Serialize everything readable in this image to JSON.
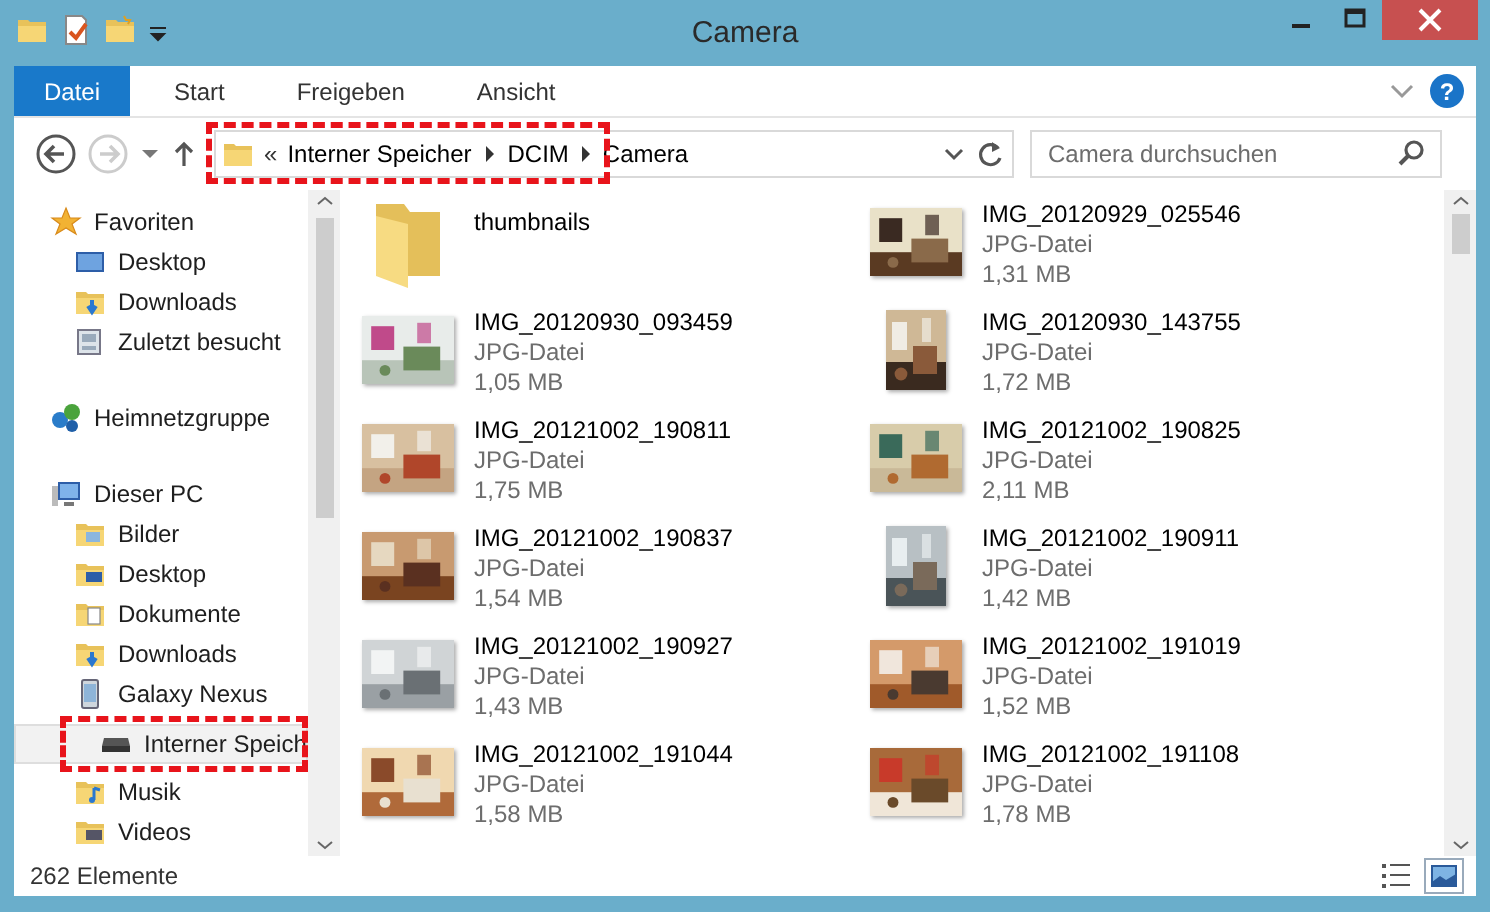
{
  "window": {
    "title": "Camera"
  },
  "ribbon": {
    "tabs": [
      {
        "label": "Datei",
        "selected": true
      },
      {
        "label": "Start",
        "selected": false
      },
      {
        "label": "Freigeben",
        "selected": false
      },
      {
        "label": "Ansicht",
        "selected": false
      }
    ],
    "help": "?"
  },
  "address_bar": {
    "overflow": "«",
    "segments": [
      "Interner Speicher",
      "DCIM",
      "Camera"
    ],
    "highlighted": true
  },
  "search": {
    "placeholder": "Camera durchsuchen"
  },
  "navigation": [
    {
      "label": "Favoriten",
      "kind": "star",
      "selected": false,
      "highlighted": false,
      "children": [
        {
          "label": "Desktop",
          "kind": "desktop",
          "selected": false,
          "highlighted": false
        },
        {
          "label": "Downloads",
          "kind": "downloads",
          "selected": false,
          "highlighted": false
        },
        {
          "label": "Zuletzt besucht",
          "kind": "recent",
          "selected": false,
          "highlighted": false
        }
      ]
    },
    {
      "label": "Heimnetzgruppe",
      "kind": "network",
      "selected": false,
      "highlighted": false
    },
    {
      "label": "Dieser PC",
      "kind": "pc",
      "selected": false,
      "highlighted": false,
      "children": [
        {
          "label": "Bilder",
          "kind": "pictures",
          "selected": false,
          "highlighted": false
        },
        {
          "label": "Desktop",
          "kind": "desktopfolder",
          "selected": false,
          "highlighted": false
        },
        {
          "label": "Dokumente",
          "kind": "documents",
          "selected": false,
          "highlighted": false
        },
        {
          "label": "Downloads",
          "kind": "downloads",
          "selected": false,
          "highlighted": false
        },
        {
          "label": "Galaxy Nexus",
          "kind": "phone",
          "selected": false,
          "highlighted": false,
          "children": [
            {
              "label": "Interner Speich",
              "kind": "drive",
              "selected": true,
              "highlighted": true
            }
          ]
        },
        {
          "label": "Musik",
          "kind": "music",
          "selected": false,
          "highlighted": false
        },
        {
          "label": "Videos",
          "kind": "videos",
          "selected": false,
          "highlighted": false
        }
      ]
    }
  ],
  "files": [
    {
      "kind": "folder",
      "name": "thumbnails"
    },
    {
      "name": "IMG_20120929_025546",
      "type": "JPG-Datei",
      "size": "1,31 MB"
    },
    {
      "name": "IMG_20120930_093459",
      "type": "JPG-Datei",
      "size": "1,05 MB"
    },
    {
      "name": "IMG_20120930_143755",
      "type": "JPG-Datei",
      "size": "1,72 MB"
    },
    {
      "name": "IMG_20121002_190811",
      "type": "JPG-Datei",
      "size": "1,75 MB"
    },
    {
      "name": "IMG_20121002_190825",
      "type": "JPG-Datei",
      "size": "2,11 MB"
    },
    {
      "name": "IMG_20121002_190837",
      "type": "JPG-Datei",
      "size": "1,54 MB"
    },
    {
      "name": "IMG_20121002_190911",
      "type": "JPG-Datei",
      "size": "1,42 MB"
    },
    {
      "name": "IMG_20121002_190927",
      "type": "JPG-Datei",
      "size": "1,43 MB"
    },
    {
      "name": "IMG_20121002_191019",
      "type": "JPG-Datei",
      "size": "1,52 MB"
    },
    {
      "name": "IMG_20121002_191044",
      "type": "JPG-Datei",
      "size": "1,58 MB"
    },
    {
      "name": "IMG_20121002_191108",
      "type": "JPG-Datei",
      "size": "1,78 MB"
    }
  ],
  "status_bar": {
    "count": "262 Elemente",
    "views": [
      {
        "kind": "details",
        "selected": false
      },
      {
        "kind": "large_icons",
        "selected": true
      }
    ]
  }
}
